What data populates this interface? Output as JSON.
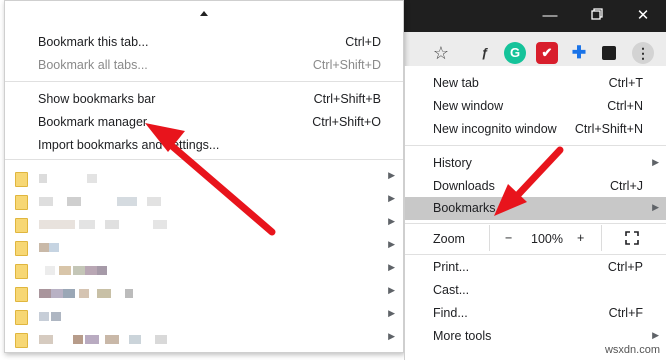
{
  "window": {
    "minimize_icon": "minimize-icon",
    "restore_icon": "restore-icon",
    "close_icon": "close-icon"
  },
  "toolbar": {
    "extensions": [
      "star-icon",
      "extension-f-icon",
      "grammarly-icon",
      "extension-red-icon",
      "puzzle-icon",
      "profile-icon",
      "menu-dots-icon"
    ]
  },
  "bookmarks_menu": {
    "items": [
      {
        "label": "Bookmark this tab...",
        "shortcut": "Ctrl+D"
      },
      {
        "label": "Bookmark all tabs...",
        "shortcut": "Ctrl+Shift+D"
      },
      {
        "label": "Show bookmarks bar",
        "shortcut": "Ctrl+Shift+B"
      },
      {
        "label": "Bookmark manager",
        "shortcut": "Ctrl+Shift+O"
      },
      {
        "label": "Import bookmarks and settings..."
      }
    ],
    "folder_count": 8
  },
  "main_menu": {
    "new_tab": {
      "label": "New tab",
      "shortcut": "Ctrl+T"
    },
    "new_window": {
      "label": "New window",
      "shortcut": "Ctrl+N"
    },
    "new_incognito": {
      "label": "New incognito window",
      "shortcut": "Ctrl+Shift+N"
    },
    "history": {
      "label": "History"
    },
    "downloads": {
      "label": "Downloads",
      "shortcut": "Ctrl+J"
    },
    "bookmarks": {
      "label": "Bookmarks"
    },
    "zoom": {
      "label": "Zoom",
      "minus": "−",
      "value": "100%",
      "plus": "+"
    },
    "print": {
      "label": "Print...",
      "shortcut": "Ctrl+P"
    },
    "cast": {
      "label": "Cast..."
    },
    "find": {
      "label": "Find...",
      "shortcut": "Ctrl+F"
    },
    "more_tools": {
      "label": "More tools"
    }
  },
  "watermark": "wsxdn.com",
  "colors": {
    "arrow": "#e8141c",
    "highlight": "#c8c8c8",
    "titlebar": "#1f1f1f"
  }
}
